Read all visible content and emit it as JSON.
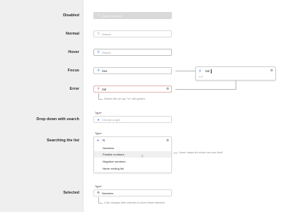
{
  "labels": {
    "disabled": "Disabled",
    "normal": "Normal",
    "hover": "Hover",
    "focus": "Focus",
    "error": "Error",
    "dropdown": "Drop down with search",
    "searching": "Searching the list",
    "selected": "Selected"
  },
  "disabled_field": {
    "placeholder": "Search is locked"
  },
  "normal_field": {
    "placeholder": "Search"
  },
  "hover_field": {
    "placeholder": "Search"
  },
  "focus_field": {
    "typed": "Sea"
  },
  "focus_popover": {
    "typed": "Sal",
    "hint": "d70"
  },
  "error_field": {
    "typed": "Sal",
    "note": "Shakes like we say \"no\" with gesture"
  },
  "type_label": "Type",
  "required_mark": "*",
  "dropdown_field": {
    "placeholder": "Choose a type"
  },
  "search_field": {
    "typed": "N"
  },
  "list_items": [
    "Numbers",
    "Positive numbers",
    "Negative numbers",
    "Never ending list"
  ],
  "hover_note": "Hover makes the whole row zone itself",
  "selected_field": {
    "value": "Numbers"
  },
  "selected_note": "Color changes after selection to show viewer attention"
}
